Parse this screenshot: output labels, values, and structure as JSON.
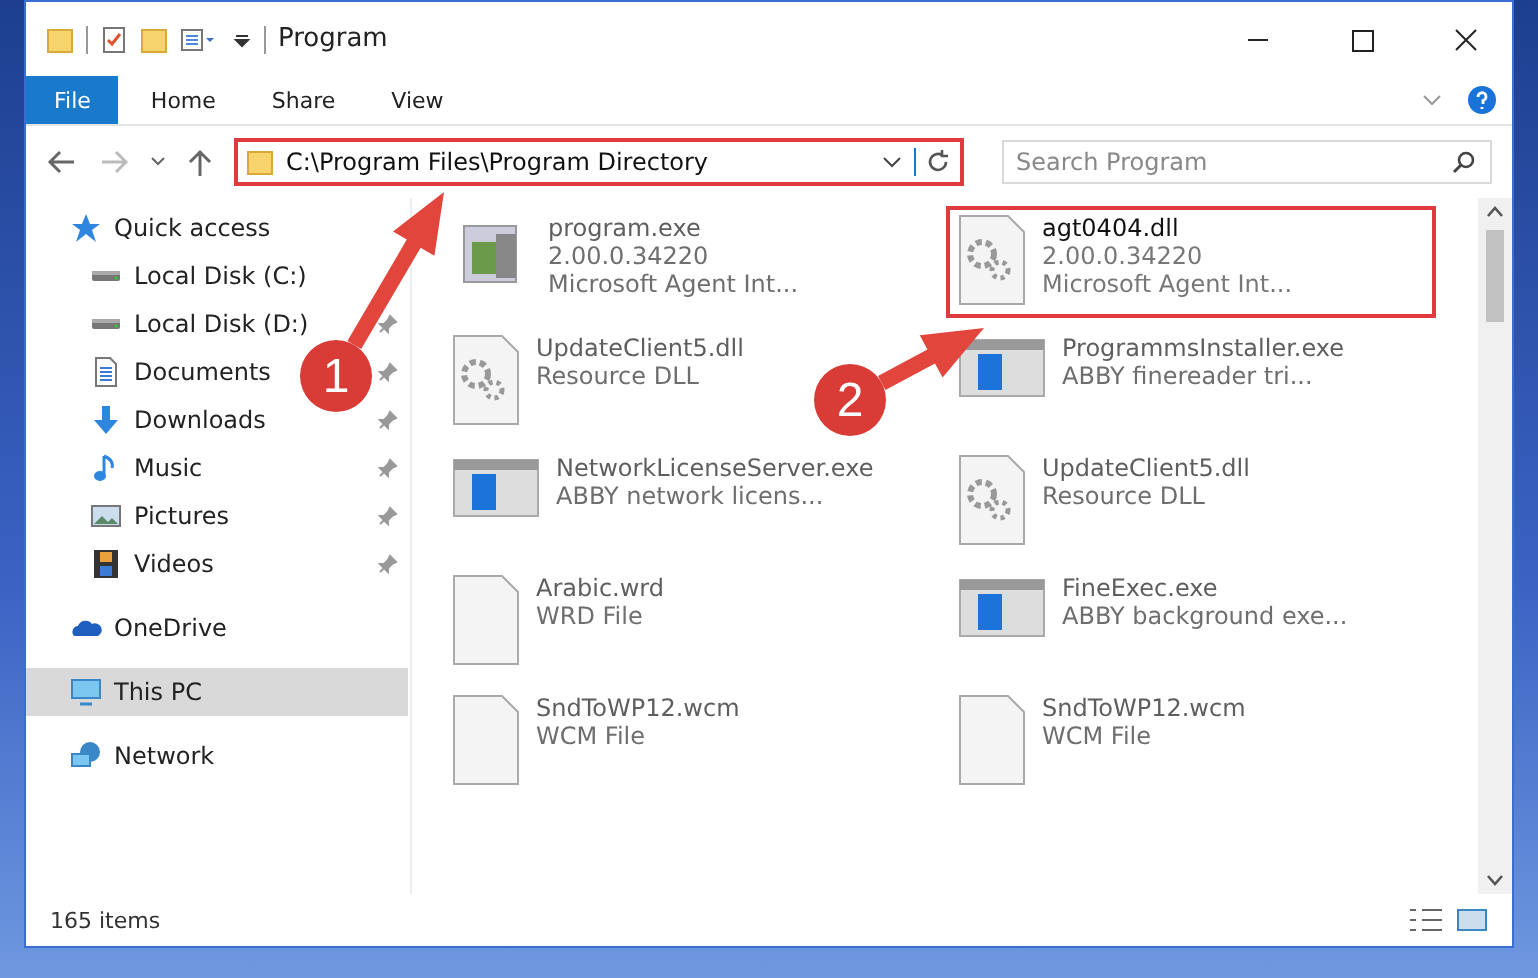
{
  "window": {
    "title": "Program"
  },
  "ribbon_tabs": [
    {
      "label": "File",
      "selected": true
    },
    {
      "label": "Home",
      "selected": false
    },
    {
      "label": "Share",
      "selected": false
    },
    {
      "label": "View",
      "selected": false
    }
  ],
  "address": {
    "value": "C:\\Program Files\\Program Directory",
    "highlighted": true
  },
  "search": {
    "placeholder": "Search Program"
  },
  "sidebar": {
    "items": [
      {
        "label": "Quick access",
        "kind": "star",
        "pinned": false,
        "selected": false
      },
      {
        "label": "Local Disk (C:)",
        "kind": "disk",
        "pinned": false,
        "selected": false
      },
      {
        "label": "Local Disk (D:)",
        "kind": "disk",
        "pinned": true,
        "selected": false
      },
      {
        "label": "Documents",
        "kind": "doc",
        "pinned": true,
        "selected": false
      },
      {
        "label": "Downloads",
        "kind": "download",
        "pinned": true,
        "selected": false
      },
      {
        "label": "Music",
        "kind": "music",
        "pinned": true,
        "selected": false
      },
      {
        "label": "Pictures",
        "kind": "pictures",
        "pinned": true,
        "selected": false
      },
      {
        "label": "Videos",
        "kind": "videos",
        "pinned": true,
        "selected": false
      },
      {
        "label": "OneDrive",
        "kind": "cloud",
        "pinned": false,
        "selected": false
      },
      {
        "label": "This PC",
        "kind": "pc",
        "pinned": false,
        "selected": true
      },
      {
        "label": "Network",
        "kind": "network",
        "pinned": false,
        "selected": false
      }
    ]
  },
  "files": [
    {
      "name": "program.exe",
      "details": [
        "2.00.0.34220",
        "Microsoft Agent Int..."
      ],
      "kind": "installer",
      "blurred": true,
      "highlighted": false
    },
    {
      "name": "agt0404.dll",
      "details": [
        "2.00.0.34220",
        "Microsoft Agent Int..."
      ],
      "kind": "dll",
      "blurred": false,
      "highlighted": true
    },
    {
      "name": "UpdateClient5.dll",
      "details": [
        "Resource DLL"
      ],
      "kind": "dll",
      "blurred": true,
      "highlighted": false
    },
    {
      "name": "ProgrammsInstaller.exe",
      "details": [
        "ABBY finereader tri..."
      ],
      "kind": "app",
      "blurred": true,
      "highlighted": false
    },
    {
      "name": "NetworkLicenseServer.exe",
      "details": [
        "ABBY network licens..."
      ],
      "kind": "app",
      "blurred": true,
      "highlighted": false
    },
    {
      "name": "UpdateClient5.dll",
      "details": [
        "Resource DLL"
      ],
      "kind": "dll",
      "blurred": true,
      "highlighted": false
    },
    {
      "name": "Arabic.wrd",
      "details": [
        "WRD File"
      ],
      "kind": "blank",
      "blurred": true,
      "highlighted": false
    },
    {
      "name": "FineExec.exe",
      "details": [
        "ABBY background exe..."
      ],
      "kind": "app",
      "blurred": true,
      "highlighted": false
    },
    {
      "name": "SndToWP12.wcm",
      "details": [
        "WCM File"
      ],
      "kind": "blank",
      "blurred": true,
      "highlighted": false
    },
    {
      "name": "SndToWP12.wcm",
      "details": [
        "WCM File"
      ],
      "kind": "blank",
      "blurred": true,
      "highlighted": false
    }
  ],
  "annotations": [
    {
      "label": "1"
    },
    {
      "label": "2"
    }
  ],
  "status_bar": {
    "count": "165 items"
  }
}
